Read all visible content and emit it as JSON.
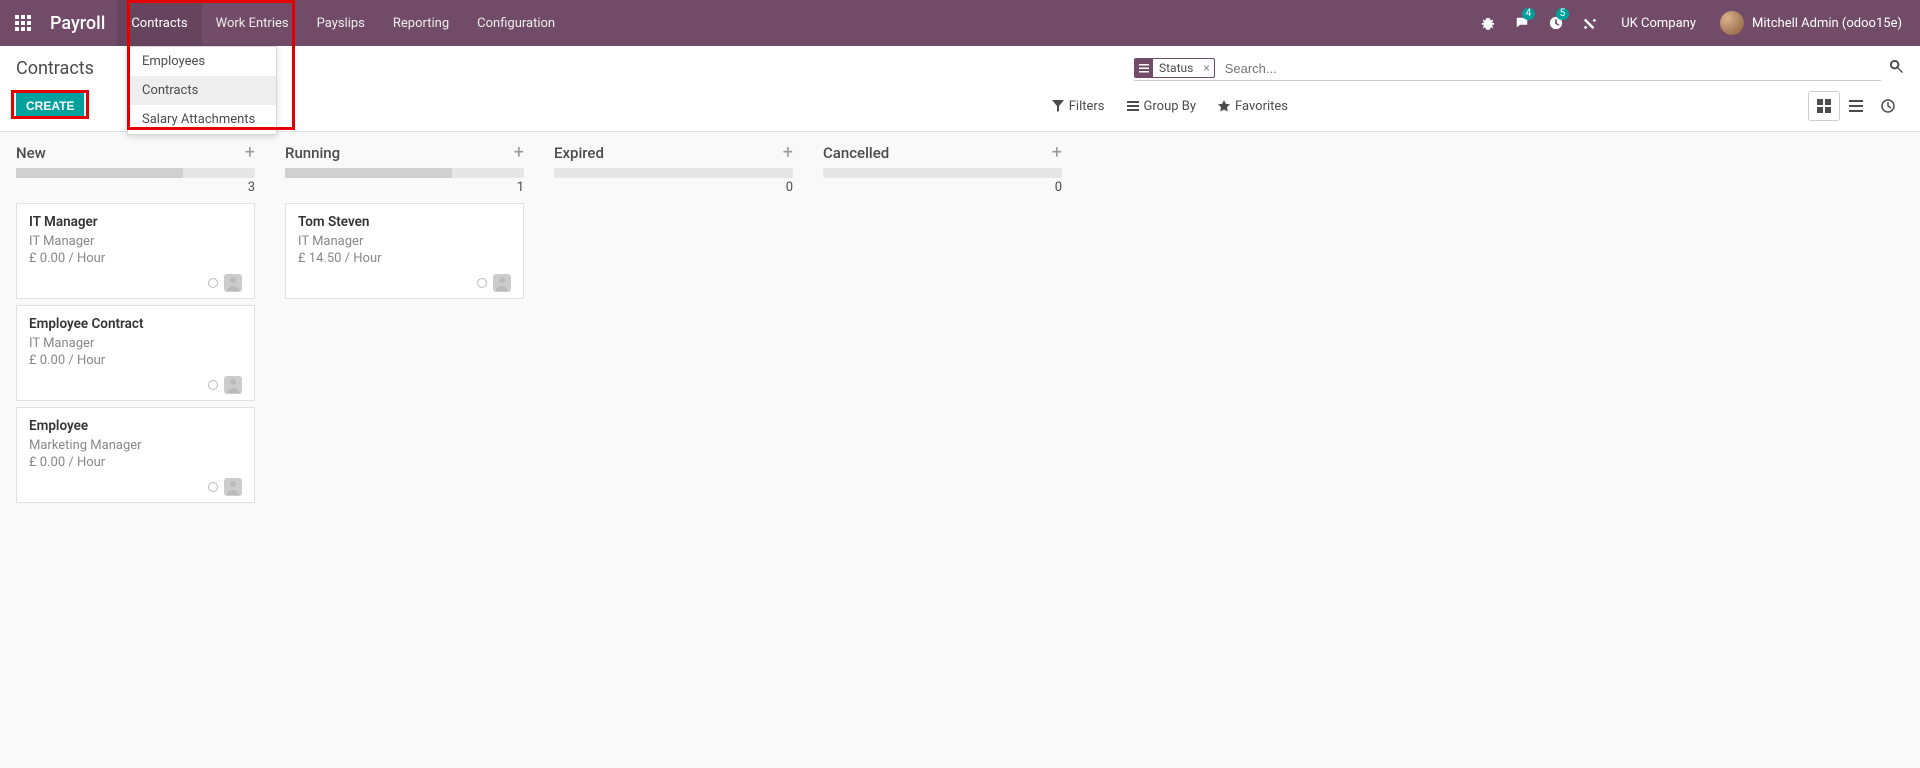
{
  "header": {
    "brand": "Payroll",
    "nav": [
      "Contracts",
      "Work Entries",
      "Payslips",
      "Reporting",
      "Configuration"
    ],
    "active_nav": "Contracts",
    "msg_badge": "4",
    "activity_badge": "5",
    "company": "UK Company",
    "user": "Mitchell Admin (odoo15e)"
  },
  "dropdown": {
    "items": [
      "Employees",
      "Contracts",
      "Salary Attachments"
    ],
    "hover": "Contracts"
  },
  "cp": {
    "title": "Contracts",
    "create": "CREATE",
    "facet": "Status",
    "search_placeholder": "Search...",
    "filters": "Filters",
    "groupby": "Group By",
    "favorites": "Favorites"
  },
  "kanban": {
    "cols": [
      {
        "title": "New",
        "count": "3",
        "fill": 70,
        "cards": [
          {
            "title": "IT Manager",
            "sub": "IT Manager",
            "rate": "£ 0.00 / Hour"
          },
          {
            "title": "Employee Contract",
            "sub": "IT Manager",
            "rate": "£ 0.00 / Hour"
          },
          {
            "title": "Employee",
            "sub": "Marketing Manager",
            "rate": "£ 0.00 / Hour"
          }
        ]
      },
      {
        "title": "Running",
        "count": "1",
        "fill": 70,
        "cards": [
          {
            "title": "Tom Steven",
            "sub": "IT Manager",
            "rate": "£ 14.50 / Hour"
          }
        ]
      },
      {
        "title": "Expired",
        "count": "0",
        "fill": 0,
        "cards": []
      },
      {
        "title": "Cancelled",
        "count": "0",
        "fill": 0,
        "cards": []
      }
    ]
  }
}
